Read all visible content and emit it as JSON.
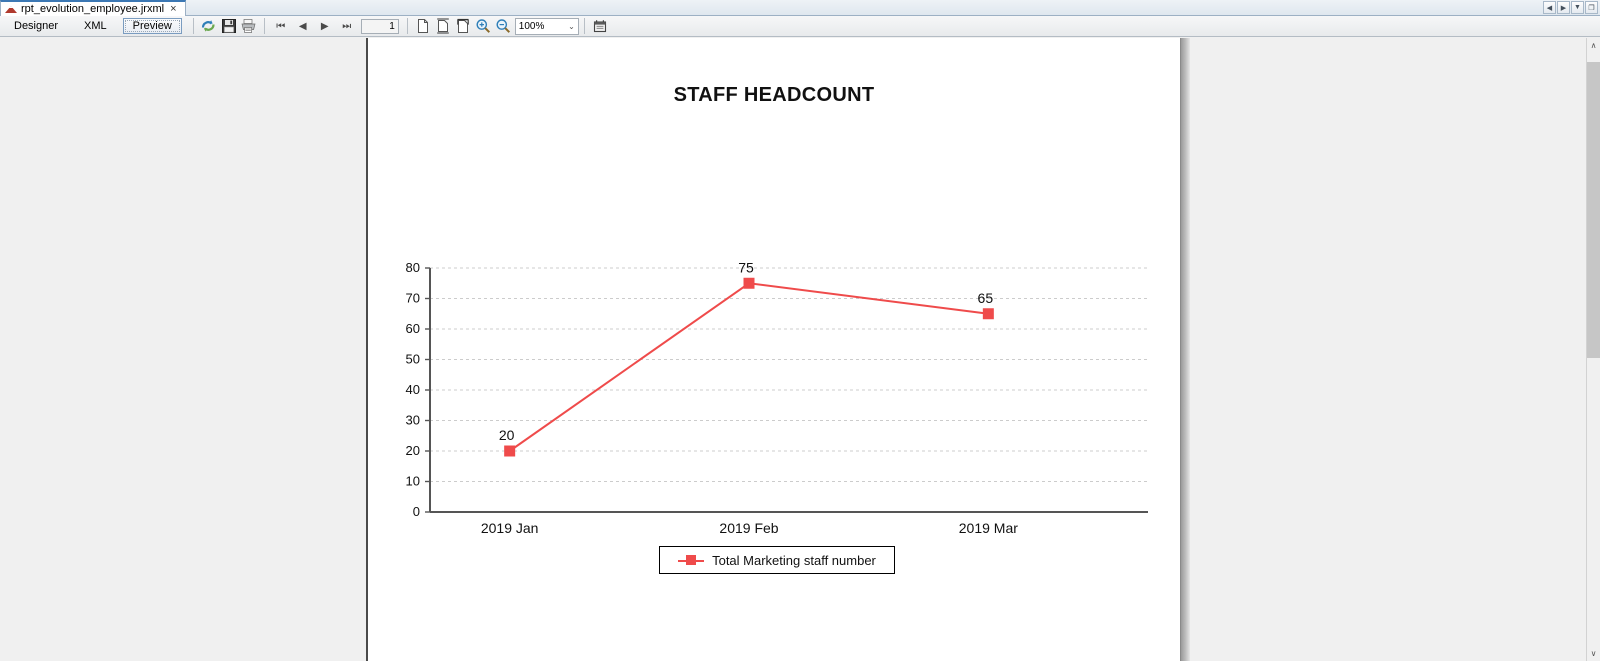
{
  "window": {
    "tab": {
      "label": "rpt_evolution_employee.jrxml",
      "close": "×",
      "icon": "jrxml-report-icon"
    },
    "tabstrip_buttons": [
      {
        "name": "scroll-tabs-left",
        "glyph": "◀"
      },
      {
        "name": "scroll-tabs-right",
        "glyph": "▶"
      },
      {
        "name": "tab-list-dropdown",
        "glyph": "▼"
      },
      {
        "name": "maximize-window",
        "glyph": "❐"
      }
    ]
  },
  "toolbar": {
    "view_tabs": [
      {
        "label": "Designer",
        "active": false
      },
      {
        "label": "XML",
        "active": false
      },
      {
        "label": "Preview",
        "active": true
      }
    ],
    "buttons": [
      {
        "name": "refresh-report-button",
        "title": "Refresh"
      },
      {
        "name": "save-button",
        "title": "Save"
      },
      {
        "name": "print-button",
        "title": "Print"
      }
    ],
    "nav": [
      {
        "name": "first-page-button",
        "glyph": "⏮"
      },
      {
        "name": "previous-page-button",
        "glyph": "◀"
      },
      {
        "name": "next-page-button",
        "glyph": "▶"
      },
      {
        "name": "last-page-button",
        "glyph": "⏭"
      }
    ],
    "page_number": "1",
    "page_number_placeholder": "1",
    "view_buttons": [
      {
        "name": "actual-size-button"
      },
      {
        "name": "fit-page-button"
      },
      {
        "name": "fit-width-button"
      }
    ],
    "zoom_in": "zoom-in-icon",
    "zoom_out": "zoom-out-icon",
    "zoom_value": "100%",
    "zoom_caret": "⌄",
    "export_button": "export-report-button"
  },
  "scrollbar": {
    "up_glyph": "∧",
    "down_glyph": "∨"
  },
  "chart_data": {
    "type": "line",
    "title": "STAFF HEADCOUNT",
    "xlabel": "",
    "ylabel": "",
    "categories": [
      "2019 Jan",
      "2019 Feb",
      "2019 Mar"
    ],
    "series": [
      {
        "name": "Total Marketing staff number",
        "values": [
          20,
          75,
          65
        ],
        "color": "#ef4b4b",
        "marker": "square"
      }
    ],
    "point_labels": [
      "20",
      "75",
      "65"
    ],
    "ylim": [
      0,
      80
    ],
    "yticks": [
      0,
      10,
      20,
      30,
      40,
      50,
      60,
      70,
      80
    ],
    "ytick_labels": [
      "0",
      "10",
      "20",
      "30",
      "40",
      "50",
      "60",
      "70",
      "80"
    ],
    "grid": true,
    "grid_style": "dashed",
    "grid_color": "#cccccc",
    "axis_color": "#555555",
    "legend_position": "bottom",
    "legend_entries": [
      "Total Marketing staff number"
    ]
  }
}
